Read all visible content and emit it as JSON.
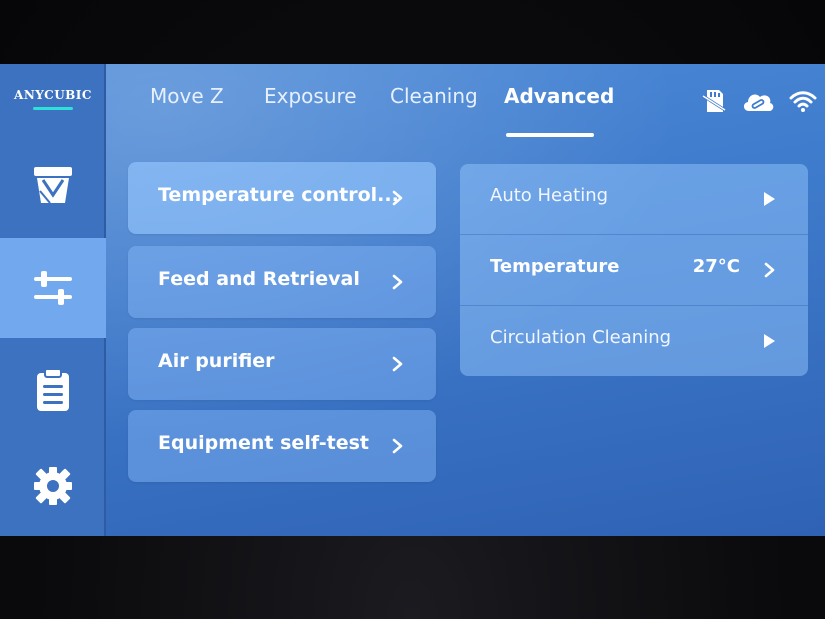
{
  "brand": {
    "name": "ANYCUBIC",
    "accent_color": "#2ee0d8"
  },
  "sidebar": {
    "items": [
      {
        "name": "print-vat",
        "icon": "resin-vat-icon",
        "active": false
      },
      {
        "name": "tools",
        "icon": "sliders-icon",
        "active": true
      },
      {
        "name": "files",
        "icon": "clipboard-icon",
        "active": false
      },
      {
        "name": "settings",
        "icon": "gear-icon",
        "active": false
      }
    ]
  },
  "tabs": [
    {
      "label": "Move Z",
      "active": false
    },
    {
      "label": "Exposure",
      "active": false
    },
    {
      "label": "Cleaning",
      "active": false
    },
    {
      "label": "Advanced",
      "active": true
    }
  ],
  "status_icons": [
    "sd-card-icon",
    "cloud-link-icon",
    "wifi-icon"
  ],
  "menu": [
    {
      "label": "Temperature control...",
      "icon": "chevron-right-icon"
    },
    {
      "label": "Feed and Retrieval",
      "icon": "chevron-right-icon"
    },
    {
      "label": "Air purifier",
      "icon": "chevron-right-icon"
    },
    {
      "label": "Equipment self-test",
      "icon": "chevron-right-icon"
    }
  ],
  "panel": {
    "rows": [
      {
        "label": "Auto Heating",
        "value": "",
        "icon": "play-icon"
      },
      {
        "label": "Temperature",
        "value": "27°C",
        "icon": "chevron-right-icon"
      },
      {
        "label": "Circulation Cleaning",
        "value": "",
        "icon": "play-icon"
      }
    ]
  },
  "colors": {
    "screen_bg": "#3f7bcc",
    "sidebar_bg": "#3c72bf",
    "sidebar_active": "#72a8ee",
    "text": "#ffffff"
  }
}
